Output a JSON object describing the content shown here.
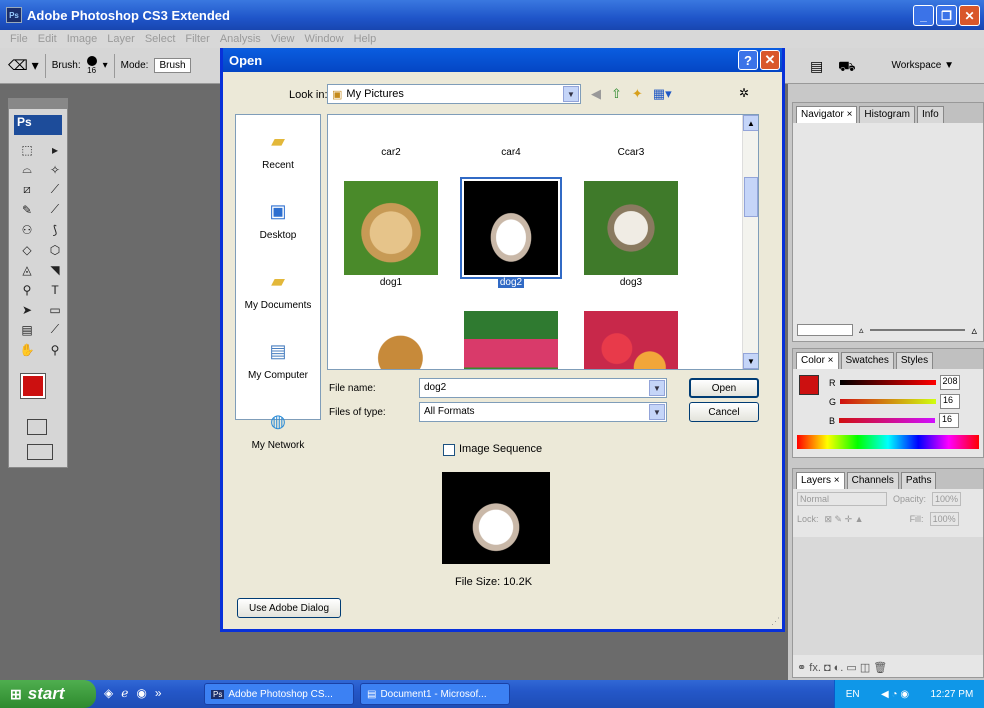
{
  "app": {
    "title": "Adobe Photoshop CS3 Extended",
    "logo": "Ps",
    "minimize": "_",
    "restore": "❐",
    "close": "✕"
  },
  "menu": [
    "File",
    "Edit",
    "Image",
    "Layer",
    "Select",
    "Filter",
    "Analysis",
    "View",
    "Window",
    "Help"
  ],
  "options": {
    "brush_label": "Brush:",
    "brush_size": "16",
    "mode_label": "Mode:",
    "mode_value": "Brush",
    "workspace": "Workspace ▼"
  },
  "toolbox": {
    "badge": "Ps",
    "fg_color": "#cc1010",
    "tools": [
      "⬚",
      "▸",
      "⌓",
      "✧",
      "⧄",
      "⟋",
      "✎",
      "⟋",
      "⚇",
      "⟆",
      "◇",
      "⬡",
      "◬",
      "◥",
      "⚲",
      "T",
      "➤",
      "▭",
      "▤",
      "⟋",
      "✋",
      "⚲"
    ]
  },
  "dialog": {
    "title": "Open",
    "help": "?",
    "close": "✕",
    "lookin_label": "Look in:",
    "lookin_value": "My Pictures",
    "places": [
      "Recent",
      "Desktop",
      "My Documents",
      "My Computer",
      "My Network"
    ],
    "files": [
      {
        "name": "car2"
      },
      {
        "name": "car4"
      },
      {
        "name": "Ccar3"
      },
      {
        "name": "dog1"
      },
      {
        "name": "dog2",
        "selected": true
      },
      {
        "name": "dog3"
      }
    ],
    "filename_label": "File name:",
    "filename_value": "dog2",
    "filetype_label": "Files of type:",
    "filetype_value": "All Formats",
    "open_button": "Open",
    "cancel_button": "Cancel",
    "image_sequence": "Image Sequence",
    "file_size": "File Size: 10.2K",
    "adobe_dialog_button": "Use Adobe Dialog"
  },
  "panels": {
    "nav_tabs": [
      "Navigator ×",
      "Histogram",
      "Info"
    ],
    "color_tabs": [
      "Color ×",
      "Swatches",
      "Styles"
    ],
    "color": {
      "r_label": "R",
      "g_label": "G",
      "b_label": "B",
      "r": "208",
      "g": "16",
      "b": "16"
    },
    "layers_tabs": [
      "Layers ×",
      "Channels",
      "Paths"
    ],
    "blend_mode": "Normal",
    "opacity_label": "Opacity:",
    "opacity_value": "100%",
    "lock_label": "Lock:",
    "fill_label": "Fill:",
    "fill_value": "100%",
    "layer_footer": "⚭  fx.  ◘  ◐.  ▭  ◫  🗑"
  },
  "taskbar": {
    "start": "start",
    "tasks": [
      "Adobe Photoshop CS...",
      "Document1 - Microsof..."
    ],
    "lang": "EN",
    "time": "12:27 PM"
  }
}
